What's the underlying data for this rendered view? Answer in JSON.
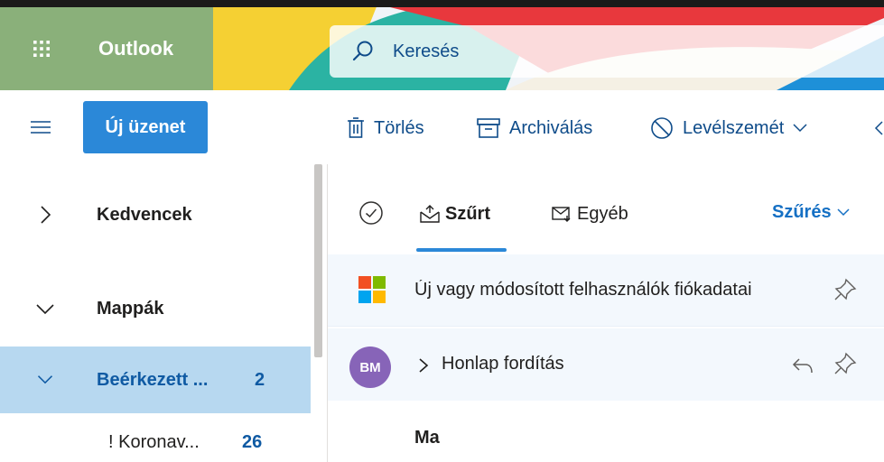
{
  "app": {
    "name": "Outlook"
  },
  "search": {
    "placeholder": "Keresés"
  },
  "toolbar": {
    "new_message": "Új üzenet",
    "delete": "Törlés",
    "archive": "Archiválás",
    "junk": "Levélszemét"
  },
  "folders": {
    "favorites": "Kedvencek",
    "folders_label": "Mappák",
    "inbox": {
      "label": "Beérkezett ...",
      "count": "2"
    },
    "subfolder": {
      "label": "! Koronav...",
      "count": "26"
    }
  },
  "list": {
    "tabs": {
      "focused": "Szűrt",
      "other": "Egyéb"
    },
    "filter_label": "Szűrés",
    "messages": [
      {
        "subject": "Új vagy módosított felhasználók fiókadatai",
        "avatar": "microsoft-logo-icon",
        "pinned": false
      },
      {
        "subject": "Honlap fordítás",
        "avatar_initials": "BM",
        "avatar_color": "#8764b8",
        "collapsed_thread": true,
        "replied": true,
        "pinned": false
      }
    ],
    "section_header": "Ma"
  },
  "colors": {
    "accent": "#2b88d8",
    "selected_folder_bg": "#b7d8f0",
    "link_blue": "#0f4c8a",
    "brand_green": "#8ab07a"
  },
  "icons": {
    "waffle": "app-launcher-icon",
    "search": "search-icon",
    "menu": "hamburger-icon",
    "delete": "trash-icon",
    "archive": "archive-box-icon",
    "junk": "block-icon",
    "select_all": "check-circle-icon",
    "pin": "pin-icon",
    "reply": "reply-icon"
  }
}
